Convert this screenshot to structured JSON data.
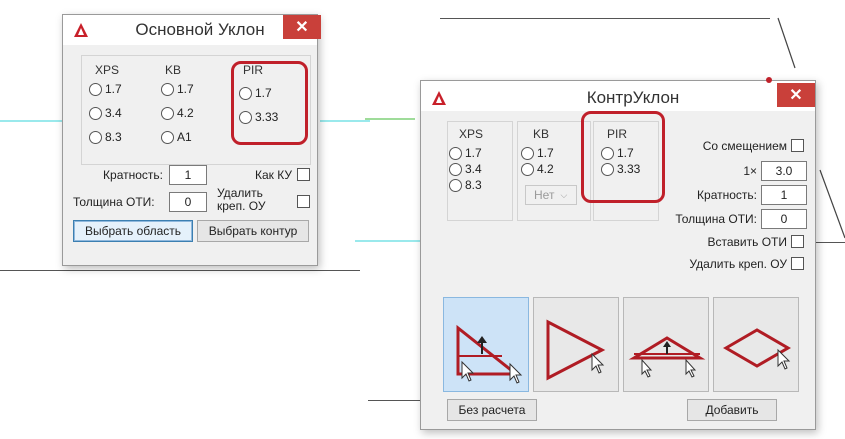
{
  "dialog1": {
    "title": "Основной Уклон",
    "close_glyph": "✕",
    "groups": [
      {
        "title": "XPS",
        "options": [
          "1.7",
          "3.4",
          "8.3"
        ]
      },
      {
        "title": "KB",
        "options": [
          "1.7",
          "4.2",
          "A1"
        ]
      },
      {
        "title": "PIR",
        "options": [
          "1.7",
          "3.33"
        ]
      }
    ],
    "multiplicity_label": "Кратность:",
    "multiplicity_value": "1",
    "as_ku_label": "Как КУ",
    "thickness_label": "Толщина ОТИ:",
    "thickness_value": "0",
    "delete_fastening_label_1": "Удалить",
    "delete_fastening_label_2": "креп. ОУ",
    "select_area_button": "Выбрать область",
    "select_contour_button": "Выбрать контур"
  },
  "dialog2": {
    "title": "КонтрУклон",
    "close_glyph": "✕",
    "groups": [
      {
        "title": "XPS",
        "options": [
          "1.7",
          "3.4",
          "8.3"
        ]
      },
      {
        "title": "KB",
        "options": [
          "1.7",
          "4.2"
        ]
      },
      {
        "title": "PIR",
        "options": [
          "1.7",
          "3.33"
        ]
      }
    ],
    "kb_select_value": "Нет",
    "with_offset_label": "Со смещением",
    "offset_factor_label": "1×",
    "offset_factor_value": "3.0",
    "multiplicity_label": "Кратность:",
    "multiplicity_value": "1",
    "thickness_label": "Толщина ОТИ:",
    "thickness_value": "0",
    "insert_oti_label": "Вставить ОТИ",
    "delete_fastening_label": "Удалить креп. ОУ",
    "tool_icons": [
      "triangle-slope-icon",
      "triangle-pointer-icon",
      "flat-triangle-icon",
      "rhombus-icon"
    ],
    "no_calc_button": "Без расчета",
    "add_button": "Добавить"
  },
  "colors": {
    "highlight": "#c0202a",
    "close_button": "#c9403a",
    "autocad_red": "#c8202a",
    "line_cyan": "#7fe6ea",
    "line_green": "#8ed98a"
  }
}
